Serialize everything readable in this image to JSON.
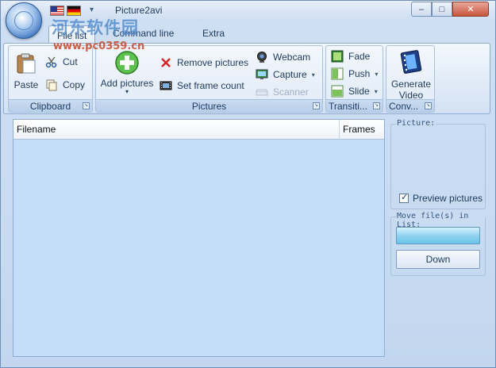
{
  "window": {
    "title": "Picture2avi",
    "controls": {
      "minimize": "–",
      "maximize": "□",
      "close": "✕"
    }
  },
  "watermark": {
    "text": "河东软件园",
    "url": "www.pc0359.cn"
  },
  "tabs": [
    {
      "label": "File list",
      "active": true
    },
    {
      "label": "Command line",
      "active": false
    },
    {
      "label": "Extra",
      "active": false
    }
  ],
  "ribbon": {
    "clipboard": {
      "label": "Clipboard",
      "paste": "Paste",
      "cut": "Cut",
      "copy": "Copy"
    },
    "pictures": {
      "label": "Pictures",
      "add": "Add pictures",
      "remove": "Remove pictures",
      "set_frame_count": "Set frame count",
      "webcam": "Webcam",
      "capture": "Capture",
      "scanner": "Scanner"
    },
    "transitions": {
      "label": "Transiti...",
      "fade": "Fade",
      "push": "Push",
      "slide": "Slide"
    },
    "convert": {
      "label": "Conv...",
      "generate_line1": "Generate",
      "generate_line2": "Video"
    }
  },
  "file_list": {
    "columns": [
      "Filename",
      "Frames"
    ],
    "rows": []
  },
  "side": {
    "picture_legend": "Picture:",
    "preview_label": "Preview pictures",
    "preview_checked": true,
    "move_legend": "Move file(s) in List:",
    "down_label": "Down"
  },
  "colors": {
    "list_background": "#c3dcf8",
    "ribbon_border": "#8eabd1",
    "accent": "#3b74c0"
  }
}
